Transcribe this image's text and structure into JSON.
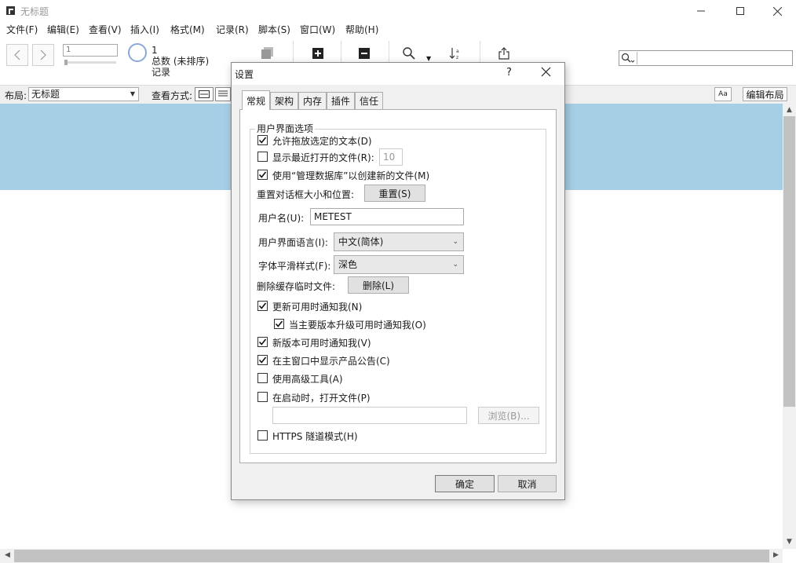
{
  "window": {
    "title": "无标题"
  },
  "menu": [
    "文件(F)",
    "编辑(E)",
    "查看(V)",
    "插入(I)",
    "格式(M)",
    "记录(R)",
    "脚本(S)",
    "窗口(W)",
    "帮助(H)"
  ],
  "toolbar": {
    "record_number": "1",
    "record_count": "1",
    "total_label": "总数 (未排序)",
    "records_label": "记录",
    "search_placeholder": ""
  },
  "layoutbar": {
    "layout_label": "布局:",
    "layout_value": "无标题",
    "view_label": "查看方式:",
    "aa_label": "Aa",
    "edit_layout_label": "编辑布局"
  },
  "dialog": {
    "title": "设置",
    "help": "?",
    "tabs": [
      "常规",
      "架构",
      "内存",
      "插件",
      "信任"
    ],
    "group_title": "用户界面选项",
    "options": {
      "allow_drag": {
        "label": "允许拖放选定的文本(D)",
        "checked": true
      },
      "show_recent": {
        "label": "显示最近打开的文件(R):",
        "checked": false,
        "value": "10"
      },
      "use_manage_db": {
        "label": "使用“管理数据库”以创建新的文件(M)",
        "checked": true
      }
    },
    "reset_label": "重置对话框大小和位置:",
    "reset_button": "重置(S)",
    "username_label": "用户名(U):",
    "username_value": "METEST",
    "ui_language_label": "用户界面语言(I):",
    "ui_language_value": "中文(简体)",
    "font_smoothing_label": "字体平滑样式(F):",
    "font_smoothing_value": "深色",
    "delete_cache_label": "删除缓存临时文件:",
    "delete_button": "删除(L)",
    "notifications": {
      "update_notify": {
        "label": "更新可用时通知我(N)",
        "checked": true
      },
      "major_upgrade": {
        "label": "当主要版本升级可用时通知我(O)",
        "checked": true
      },
      "new_version": {
        "label": "新版本可用时通知我(V)",
        "checked": true
      },
      "product_news": {
        "label": "在主窗口中显示产品公告(C)",
        "checked": true
      },
      "advanced_tools": {
        "label": "使用高级工具(A)",
        "checked": false
      },
      "open_on_start": {
        "label": "在启动时，打开文件(P)",
        "checked": false
      },
      "https_tunnel": {
        "label": "HTTPS 隧道模式(H)",
        "checked": false
      }
    },
    "startup_file_value": "",
    "browse_button": "浏览(B)...",
    "ok_button": "确定",
    "cancel_button": "取消"
  }
}
